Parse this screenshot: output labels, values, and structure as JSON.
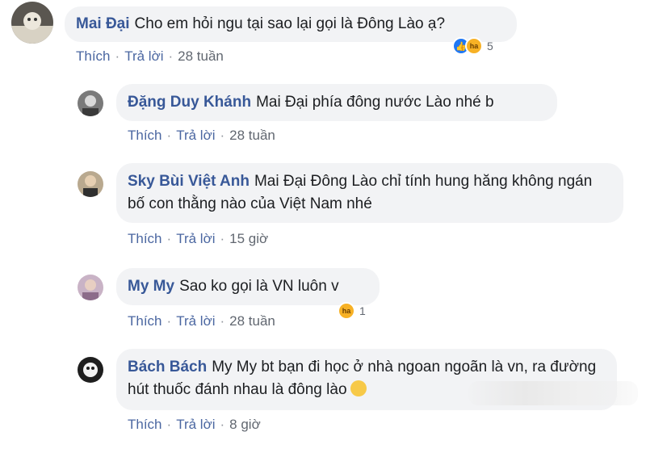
{
  "thread": {
    "main": {
      "author": "Mai Đại",
      "text": "Cho em hỏi ngu tại sao lại gọi là Đông Lào ạ?",
      "like_label": "Thích",
      "reply_label": "Trả lời",
      "time": "28 tuần",
      "reaction_icons": [
        "like-icon",
        "haha-icon"
      ],
      "reaction_count": "5"
    },
    "replies": [
      {
        "author": "Đặng Duy Khánh",
        "text": "Mai Đại phía đông nước Lào nhé b",
        "like_label": "Thích",
        "reply_label": "Trả lời",
        "time": "28 tuần"
      },
      {
        "author": "Sky Bùi Việt Anh",
        "text": "Mai Đại Đông Lào chỉ tính hung hăng không ngán bố con thằng nào của Việt Nam nhé",
        "like_label": "Thích",
        "reply_label": "Trả lời",
        "time": "15 giờ"
      },
      {
        "author": "My My",
        "text": "Sao ko gọi là VN luôn v",
        "like_label": "Thích",
        "reply_label": "Trả lời",
        "time": "28 tuần",
        "reaction_icons": [
          "haha-icon"
        ],
        "reaction_count": "1"
      },
      {
        "author": "Bách Bách",
        "text": "My My bt bạn đi học ở nhà ngoan ngoãn là vn, ra đường hút thuốc đánh nhau là đông lào",
        "like_label": "Thích",
        "reply_label": "Trả lời",
        "time": "8 giờ"
      }
    ]
  },
  "colors": {
    "name": "#385898",
    "bubble": "#f2f3f5",
    "meta": "#616770",
    "like": "#2078f4",
    "haha": "#f7b125"
  }
}
